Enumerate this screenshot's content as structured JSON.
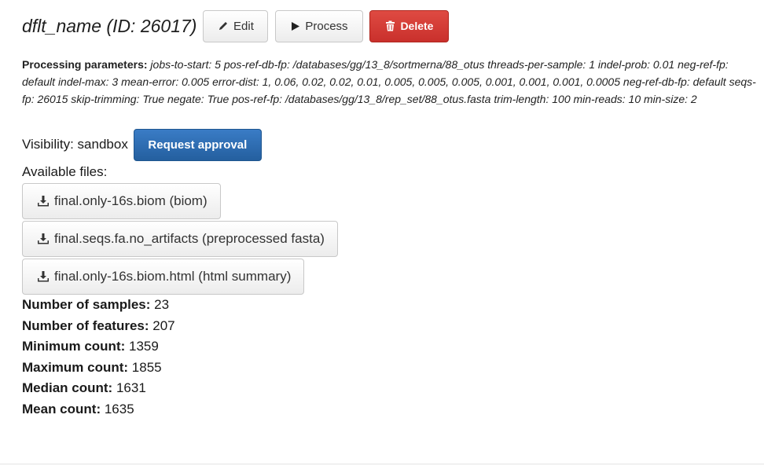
{
  "header": {
    "title": "dflt_name (ID: 26017)",
    "edit_label": "Edit",
    "process_label": "Process",
    "delete_label": "Delete"
  },
  "parameters": {
    "heading": "Processing parameters:",
    "items": [
      {
        "key": "jobs-to-start",
        "value": "5"
      },
      {
        "key": "pos-ref-db-fp",
        "value": "/databases/gg/13_8/sortmerna/88_otus"
      },
      {
        "key": "threads-per-sample",
        "value": "1"
      },
      {
        "key": "indel-prob",
        "value": "0.01"
      },
      {
        "key": "neg-ref-fp",
        "value": "default"
      },
      {
        "key": "indel-max",
        "value": "3"
      },
      {
        "key": "mean-error",
        "value": "0.005"
      },
      {
        "key": "error-dist",
        "value": "1, 0.06, 0.02, 0.02, 0.01, 0.005, 0.005, 0.005, 0.001, 0.001, 0.001, 0.0005"
      },
      {
        "key": "neg-ref-db-fp",
        "value": "default"
      },
      {
        "key": "seqs-fp",
        "value": "26015"
      },
      {
        "key": "skip-trimming",
        "value": "True"
      },
      {
        "key": "negate",
        "value": "True"
      },
      {
        "key": "pos-ref-fp",
        "value": "/databases/gg/13_8/rep_set/88_otus.fasta"
      },
      {
        "key": "trim-length",
        "value": "100"
      },
      {
        "key": "min-reads",
        "value": "10"
      },
      {
        "key": "min-size",
        "value": "2"
      }
    ]
  },
  "visibility": {
    "label": "Visibility: sandbox",
    "request_label": "Request approval"
  },
  "files": {
    "label": "Available files:",
    "items": [
      {
        "label": "final.only-16s.biom (biom)"
      },
      {
        "label": "final.seqs.fa.no_artifacts (preprocessed fasta)"
      },
      {
        "label": "final.only-16s.biom.html (html summary)"
      }
    ]
  },
  "stats": [
    {
      "key": "Number of samples:",
      "value": "23"
    },
    {
      "key": "Number of features:",
      "value": "207"
    },
    {
      "key": "Minimum count:",
      "value": "1359"
    },
    {
      "key": "Maximum count:",
      "value": "1855"
    },
    {
      "key": "Median count:",
      "value": "1631"
    },
    {
      "key": "Mean count:",
      "value": "1635"
    }
  ],
  "icons": {
    "edit": "pencil-icon",
    "process": "play-icon",
    "delete": "trash-icon",
    "download": "download-icon"
  },
  "colors": {
    "delete": "#d9534f",
    "primary": "#2e6da4"
  }
}
